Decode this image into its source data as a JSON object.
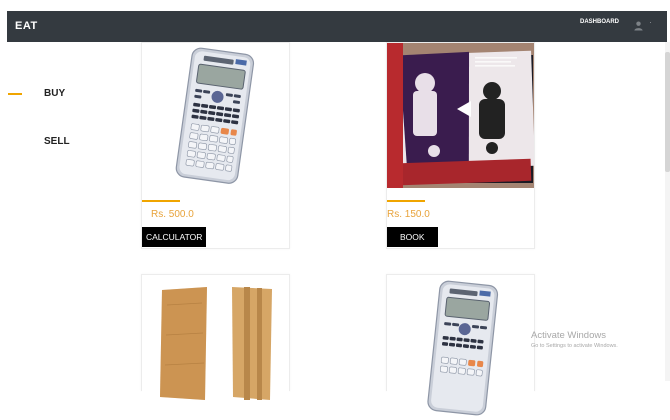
{
  "navbar": {
    "brand": "EAT",
    "dashboard_label": "DASHBOARD",
    "user_icon": "user-icon",
    "bg_color": "#343a40"
  },
  "sidebar": {
    "items": [
      {
        "label": "BUY",
        "active": true
      },
      {
        "label": "SELL",
        "active": false
      }
    ],
    "accent_color": "#f0a500"
  },
  "products": [
    {
      "image": "calculator",
      "price": "Rs. 500.0",
      "name": "CALCULATOR"
    },
    {
      "image": "book",
      "price": "Rs. 150.0",
      "name": "BOOK"
    },
    {
      "image": "wooden-boards"
    },
    {
      "image": "calculator"
    }
  ],
  "windows_watermark": {
    "title": "Activate Windows",
    "subtitle": "Go to Settings to activate Windows."
  }
}
